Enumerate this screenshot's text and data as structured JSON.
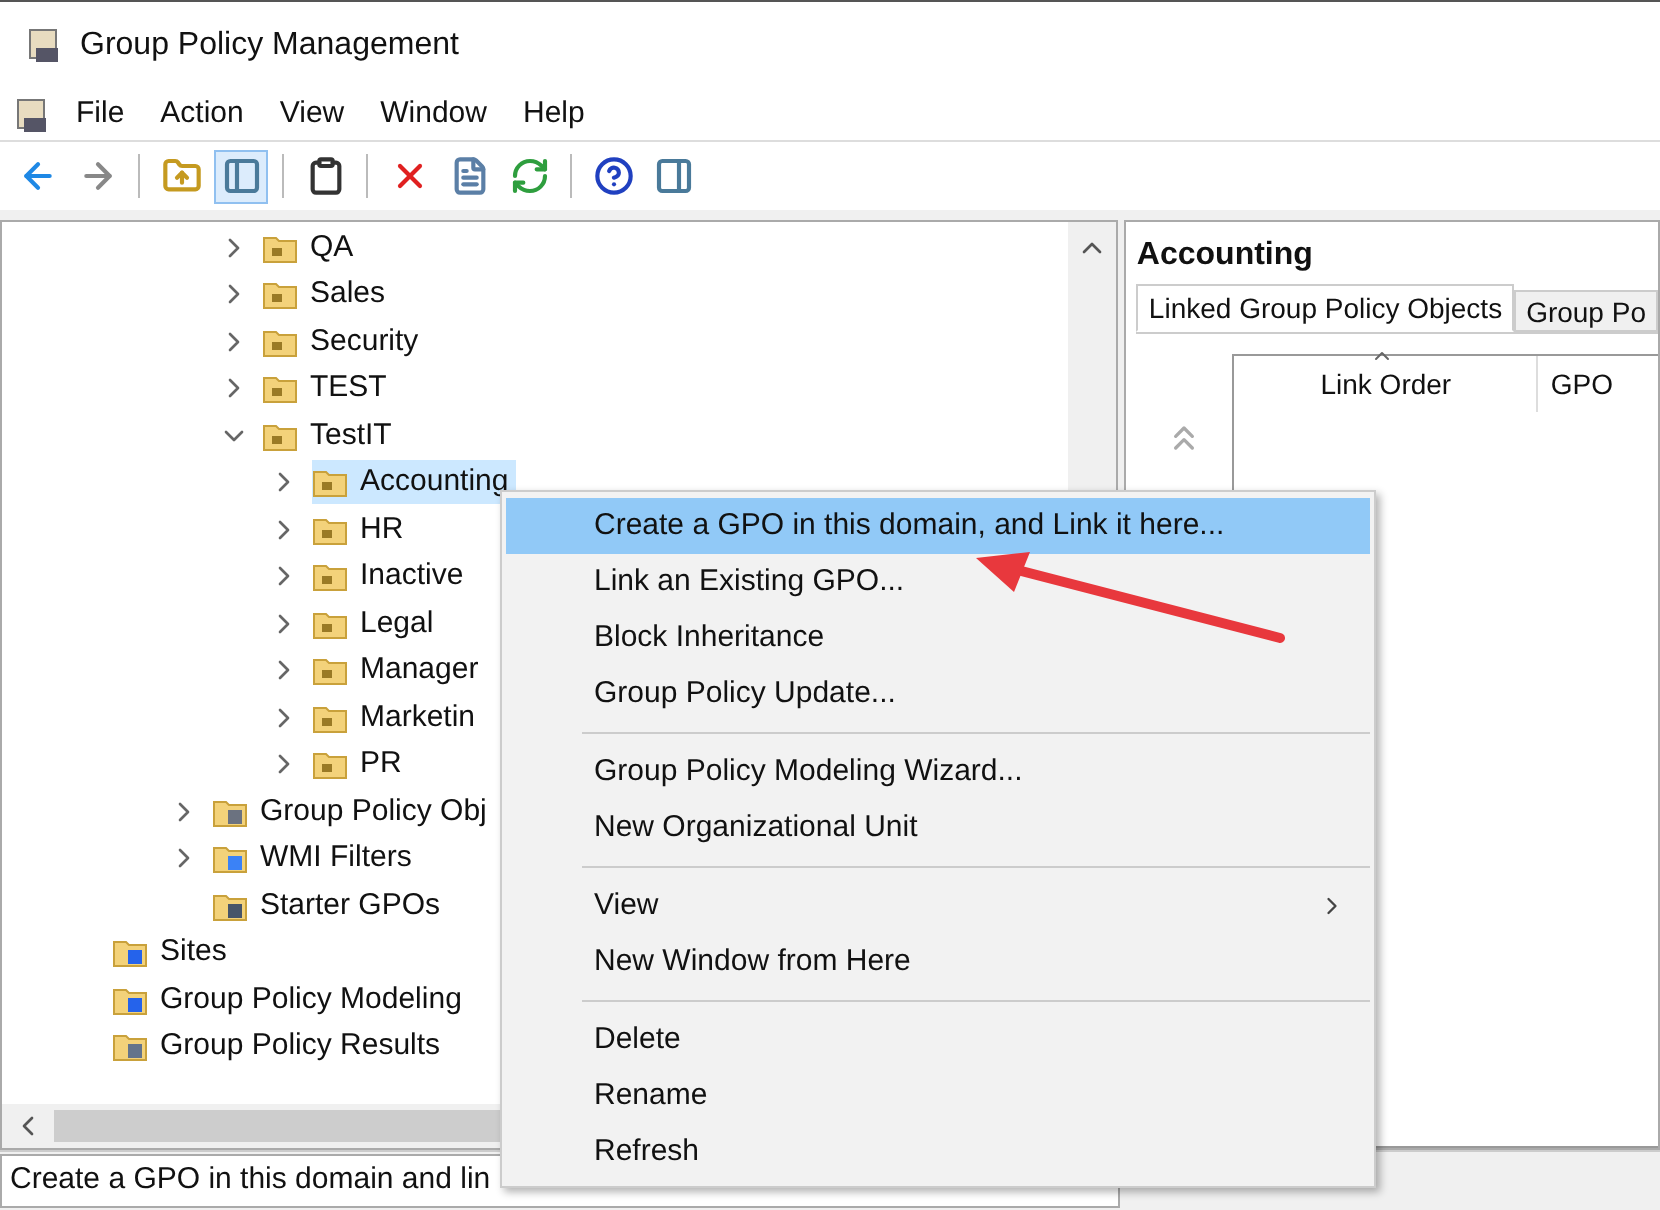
{
  "window": {
    "title": "Group Policy Management"
  },
  "menubar": [
    "File",
    "Action",
    "View",
    "Window",
    "Help"
  ],
  "toolbar": [
    {
      "kind": "back"
    },
    {
      "kind": "forward"
    },
    {
      "kind": "sep"
    },
    {
      "kind": "up",
      "pressed": false
    },
    {
      "kind": "tree",
      "pressed": true
    },
    {
      "kind": "sep"
    },
    {
      "kind": "export",
      "pressed": false
    },
    {
      "kind": "sep"
    },
    {
      "kind": "delete",
      "pressed": false
    },
    {
      "kind": "properties",
      "pressed": false
    },
    {
      "kind": "refresh",
      "pressed": false
    },
    {
      "kind": "sep"
    },
    {
      "kind": "help",
      "pressed": false
    },
    {
      "kind": "pane",
      "pressed": false
    }
  ],
  "tree": {
    "ous": [
      {
        "label": "QA",
        "expanded": false,
        "selected": false
      },
      {
        "label": "Sales",
        "expanded": false,
        "selected": false
      },
      {
        "label": "Security",
        "expanded": false,
        "selected": false
      },
      {
        "label": "TEST",
        "expanded": false,
        "selected": false
      },
      {
        "label": "TestIT",
        "expanded": true,
        "selected": false,
        "children": [
          {
            "label": "Accounting",
            "expanded": false,
            "selected": true
          },
          {
            "label": "HR",
            "expanded": false,
            "selected": false
          },
          {
            "label": "Inactive",
            "expanded": false,
            "selected": false
          },
          {
            "label": "Legal",
            "expanded": false,
            "selected": false
          },
          {
            "label": "Manager",
            "expanded": false,
            "selected": false
          },
          {
            "label": "Marketin",
            "expanded": false,
            "selected": false
          },
          {
            "label": "PR",
            "expanded": false,
            "selected": false
          }
        ]
      }
    ],
    "containers": [
      {
        "label": "Group Policy Obj",
        "expandable": true,
        "kind": "gpo"
      },
      {
        "label": "WMI Filters",
        "expandable": true,
        "kind": "filter"
      },
      {
        "label": "Starter GPOs",
        "expandable": false,
        "kind": "starter"
      }
    ],
    "roots": [
      {
        "label": "Sites",
        "kind": "sites"
      },
      {
        "label": "Group Policy Modeling",
        "kind": "modeling"
      },
      {
        "label": "Group Policy Results",
        "kind": "results"
      }
    ]
  },
  "details": {
    "title": "Accounting",
    "tabs": [
      {
        "label": "Linked Group Policy Objects",
        "selected": true
      },
      {
        "label": "Group Po",
        "selected": false
      }
    ],
    "columns": [
      "Link Order",
      "GPO"
    ]
  },
  "context_menu": [
    [
      {
        "label": "Create a GPO in this domain, and Link it here...",
        "selected": true,
        "submenu": false
      },
      {
        "label": "Link an Existing GPO...",
        "selected": false,
        "submenu": false
      },
      {
        "label": "Block Inheritance",
        "selected": false,
        "submenu": false
      },
      {
        "label": "Group Policy Update...",
        "selected": false,
        "submenu": false
      }
    ],
    [
      {
        "label": "Group Policy Modeling Wizard...",
        "selected": false,
        "submenu": false
      },
      {
        "label": "New Organizational Unit",
        "selected": false,
        "submenu": false
      }
    ],
    [
      {
        "label": "View",
        "selected": false,
        "submenu": true
      },
      {
        "label": "New Window from Here",
        "selected": false,
        "submenu": false
      }
    ],
    [
      {
        "label": "Delete",
        "selected": false,
        "submenu": false
      },
      {
        "label": "Rename",
        "selected": false,
        "submenu": false
      },
      {
        "label": "Refresh",
        "selected": false,
        "submenu": false
      }
    ]
  ],
  "status_bar": "Create a GPO in this domain and lin"
}
